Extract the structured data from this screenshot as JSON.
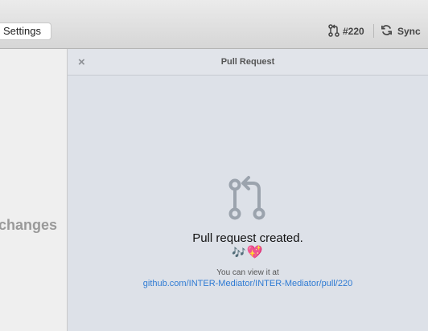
{
  "toolbar": {
    "settings_label": "Settings",
    "pr_number": "#220",
    "sync_label": "Sync"
  },
  "left_pane": {
    "changes_label": "changes"
  },
  "sheet": {
    "title": "Pull Request",
    "close_symbol": "×",
    "message": "Pull request created.",
    "emoji_notes": "🎶",
    "emoji_heart": "💖",
    "view_text": "You can view it at",
    "link_text": "github.com/INTER-Mediator/INTER-Mediator/pull/220"
  },
  "icons": {
    "pr": "git-pull-request-icon",
    "sync": "sync-icon",
    "close": "close-icon"
  },
  "colors": {
    "link": "#2f7bd3",
    "icon_gray": "#9ba3ad"
  }
}
